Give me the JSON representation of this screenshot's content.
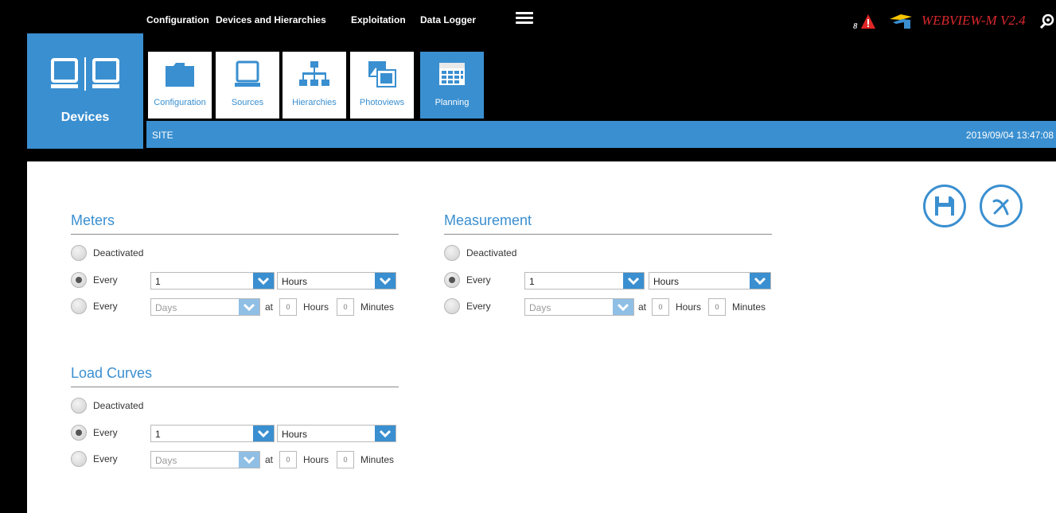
{
  "app": {
    "title": "WEBVIEW-M V2.4",
    "alert_count": "8",
    "accent_color": "#3a8fd0",
    "brand_color": "#d8282d"
  },
  "devices_tile": {
    "label": "Devices",
    "icon": "devices-icon"
  },
  "groups": {
    "configuration": "Configuration",
    "devices_and_hierarchies": "Devices and Hierarchies",
    "exploitation": "Exploitation",
    "data_logger": "Data Logger"
  },
  "ribbon": [
    {
      "label": "Configuration",
      "icon": "folder-icon"
    },
    {
      "label": "Sources",
      "icon": "monitor-icon"
    },
    {
      "label": "Hierarchies",
      "icon": "hierarchy-icon"
    },
    {
      "label": "Photoviews",
      "icon": "photo-icon"
    },
    {
      "label": "Planning",
      "icon": "calendar-icon",
      "active": true
    }
  ],
  "site_bar": {
    "site": "SITE",
    "datetime": "2019/09/04 13:47:08"
  },
  "actions": {
    "save": "save-icon",
    "cancel": "cancel-icon"
  },
  "sections": {
    "meters": {
      "title": "Meters",
      "deactivated_label": "Deactivated",
      "every_label": "Every",
      "every_value": "1",
      "every_unit": "Hours",
      "every2_label": "Every",
      "every2_unit": "Days",
      "at_label": "at",
      "hours_value": "0",
      "hours_label": "Hours",
      "minutes_value": "0",
      "minutes_label": "Minutes",
      "selected": "every"
    },
    "measurement": {
      "title": "Measurement",
      "deactivated_label": "Deactivated",
      "every_label": "Every",
      "every_value": "1",
      "every_unit": "Hours",
      "every2_label": "Every",
      "every2_unit": "Days",
      "at_label": "at",
      "hours_value": "0",
      "hours_label": "Hours",
      "minutes_value": "0",
      "minutes_label": "Minutes",
      "selected": "every"
    },
    "load_curves": {
      "title": "Load Curves",
      "deactivated_label": "Deactivated",
      "every_label": "Every",
      "every_value": "1",
      "every_unit": "Hours",
      "every2_label": "Every",
      "every2_unit": "Days",
      "at_label": "at",
      "hours_value": "0",
      "hours_label": "Hours",
      "minutes_value": "0",
      "minutes_label": "Minutes",
      "selected": "every"
    }
  }
}
